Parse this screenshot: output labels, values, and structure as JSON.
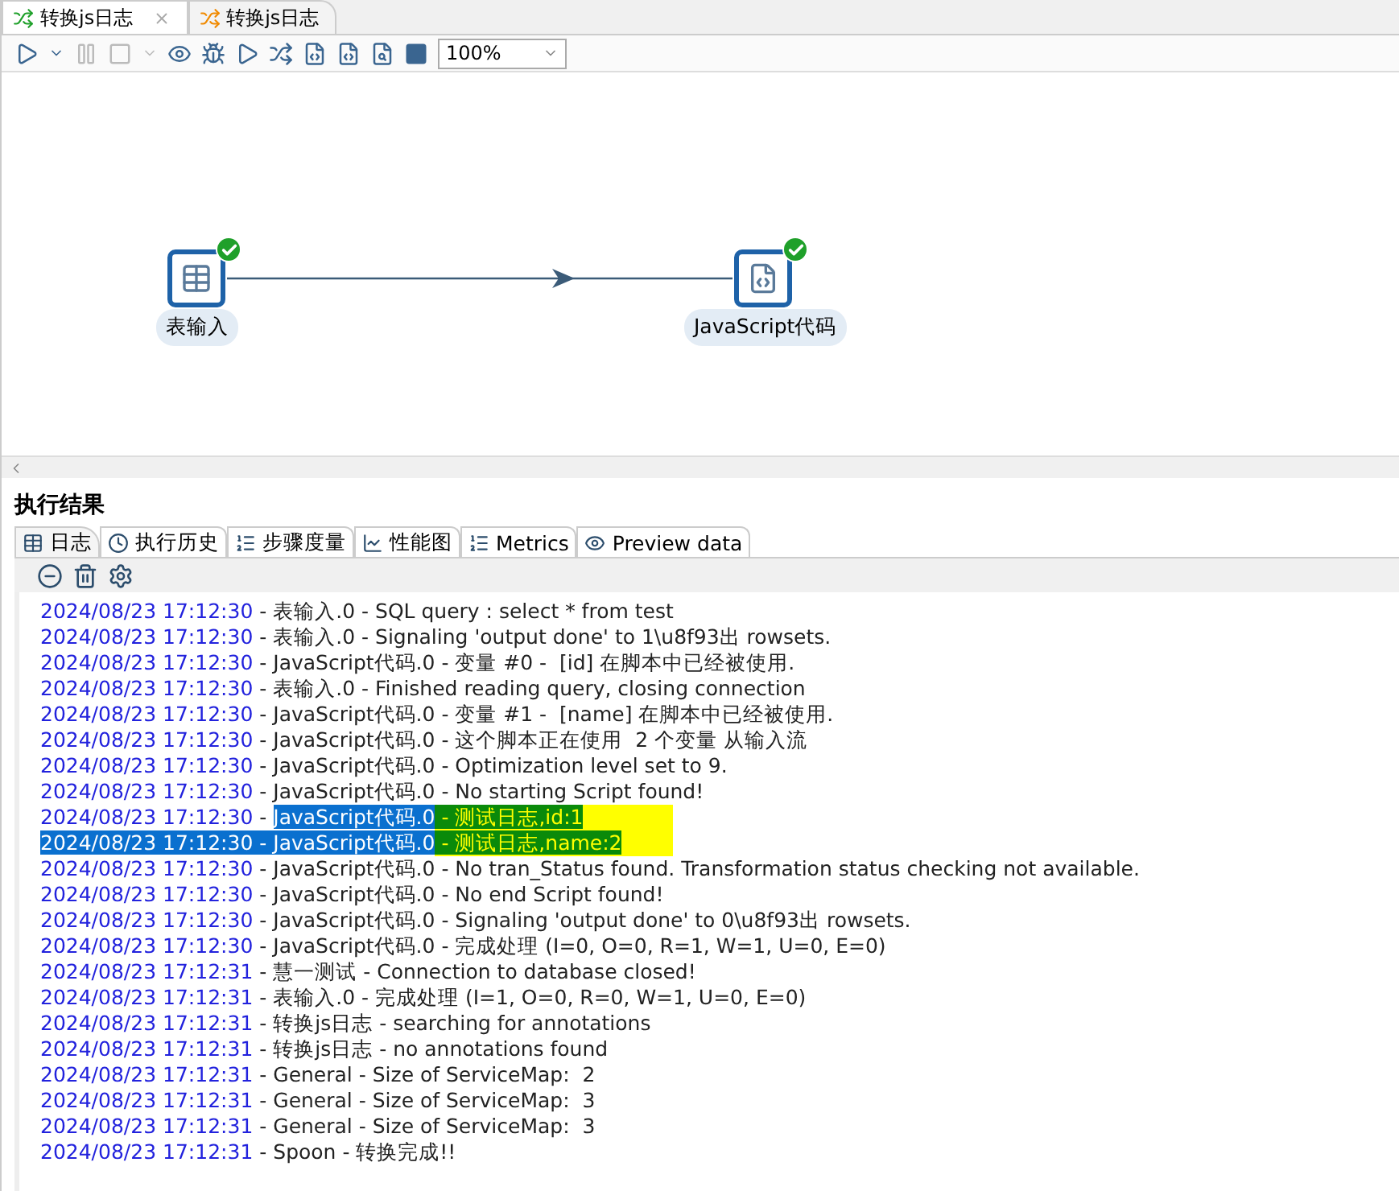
{
  "editor_tabs": [
    {
      "label": "转换js日志",
      "selected": true,
      "closable": true
    },
    {
      "label": "转换js日志",
      "selected": false,
      "closable": false
    }
  ],
  "toolbar": {
    "zoom": "100%"
  },
  "canvas": {
    "nodes": [
      {
        "label": "表输入",
        "kind": "table-input",
        "ok": true
      },
      {
        "label": "JavaScript代码",
        "kind": "script",
        "ok": true
      }
    ]
  },
  "results": {
    "title": "执行结果",
    "tabs": [
      {
        "label": "日志",
        "selected": true
      },
      {
        "label": "执行历史",
        "selected": false
      },
      {
        "label": "步骤度量",
        "selected": false
      },
      {
        "label": "性能图",
        "selected": false
      },
      {
        "label": "Metrics",
        "selected": false
      },
      {
        "label": "Preview data",
        "selected": false
      }
    ],
    "log": [
      {
        "time": "2024/08/23 17:12:30",
        "segments": [
          {
            "text": " - 表输入.0 - SQL query : select * from test",
            "selected": false,
            "highlighted": false
          }
        ],
        "time_selected": false
      },
      {
        "time": "2024/08/23 17:12:30",
        "segments": [
          {
            "text": " - 表输入.0 - Signaling 'output done' to 1\\u8f93出 rowsets.",
            "selected": false,
            "highlighted": false
          }
        ],
        "time_selected": false
      },
      {
        "time": "2024/08/23 17:12:30",
        "segments": [
          {
            "text": " - JavaScript代码.0 - 变量 #0 -  [id] 在脚本中已经被使用.",
            "selected": false,
            "highlighted": false
          }
        ],
        "time_selected": false
      },
      {
        "time": "2024/08/23 17:12:30",
        "segments": [
          {
            "text": " - 表输入.0 - Finished reading query, closing connection",
            "selected": false,
            "highlighted": false
          }
        ],
        "time_selected": false
      },
      {
        "time": "2024/08/23 17:12:30",
        "segments": [
          {
            "text": " - JavaScript代码.0 - 变量 #1 -  [name] 在脚本中已经被使用.",
            "selected": false,
            "highlighted": false
          }
        ],
        "time_selected": false
      },
      {
        "time": "2024/08/23 17:12:30",
        "segments": [
          {
            "text": " - JavaScript代码.0 - 这个脚本正在使用  2 个变量 从输入流",
            "selected": false,
            "highlighted": false
          }
        ],
        "time_selected": false
      },
      {
        "time": "2024/08/23 17:12:30",
        "segments": [
          {
            "text": " - JavaScript代码.0 - Optimization level set to 9.",
            "selected": false,
            "highlighted": false
          }
        ],
        "time_selected": false
      },
      {
        "time": "2024/08/23 17:12:30",
        "segments": [
          {
            "text": " - JavaScript代码.0 - No starting Script found!",
            "selected": false,
            "highlighted": false
          }
        ],
        "time_selected": false
      },
      {
        "time": "2024/08/23 17:12:30",
        "segments": [
          {
            "text": " - ",
            "selected": false,
            "highlighted": false
          },
          {
            "text": "JavaScript代码.0",
            "selected": true,
            "highlighted": false
          },
          {
            "text": " - 测试日志,id:1",
            "selected": true,
            "highlighted": true
          }
        ],
        "time_selected": false
      },
      {
        "time": "2024/08/23 17:12:30",
        "segments": [
          {
            "text": " - JavaScript代码.0",
            "selected": true,
            "highlighted": false
          },
          {
            "text": " - 测试日志,name:2",
            "selected": true,
            "highlighted": true
          }
        ],
        "time_selected": true
      },
      {
        "time": "2024/08/23 17:12:30",
        "segments": [
          {
            "text": " - JavaScript代码.0 - No tran_Status found. Transformation status checking not available.",
            "selected": false,
            "highlighted": false
          }
        ],
        "time_selected": false
      },
      {
        "time": "2024/08/23 17:12:30",
        "segments": [
          {
            "text": " - JavaScript代码.0 - No end Script found!",
            "selected": false,
            "highlighted": false
          }
        ],
        "time_selected": false
      },
      {
        "time": "2024/08/23 17:12:30",
        "segments": [
          {
            "text": " - JavaScript代码.0 - Signaling 'output done' to 0\\u8f93出 rowsets.",
            "selected": false,
            "highlighted": false
          }
        ],
        "time_selected": false
      },
      {
        "time": "2024/08/23 17:12:30",
        "segments": [
          {
            "text": " - JavaScript代码.0 - 完成处理 (I=0, O=0, R=1, W=1, U=0, E=0)",
            "selected": false,
            "highlighted": false
          }
        ],
        "time_selected": false
      },
      {
        "time": "2024/08/23 17:12:31",
        "segments": [
          {
            "text": " - 慧一测试 - Connection to database closed!",
            "selected": false,
            "highlighted": false
          }
        ],
        "time_selected": false
      },
      {
        "time": "2024/08/23 17:12:31",
        "segments": [
          {
            "text": " - 表输入.0 - 完成处理 (I=1, O=0, R=0, W=1, U=0, E=0)",
            "selected": false,
            "highlighted": false
          }
        ],
        "time_selected": false
      },
      {
        "time": "2024/08/23 17:12:31",
        "segments": [
          {
            "text": " - 转换js日志 - searching for annotations",
            "selected": false,
            "highlighted": false
          }
        ],
        "time_selected": false
      },
      {
        "time": "2024/08/23 17:12:31",
        "segments": [
          {
            "text": " - 转换js日志 - no annotations found",
            "selected": false,
            "highlighted": false
          }
        ],
        "time_selected": false
      },
      {
        "time": "2024/08/23 17:12:31",
        "segments": [
          {
            "text": " - General - Size of ServiceMap:  2",
            "selected": false,
            "highlighted": false
          }
        ],
        "time_selected": false
      },
      {
        "time": "2024/08/23 17:12:31",
        "segments": [
          {
            "text": " - General - Size of ServiceMap:  3",
            "selected": false,
            "highlighted": false
          }
        ],
        "time_selected": false
      },
      {
        "time": "2024/08/23 17:12:31",
        "segments": [
          {
            "text": " - General - Size of ServiceMap:  3",
            "selected": false,
            "highlighted": false
          }
        ],
        "time_selected": false
      },
      {
        "time": "2024/08/23 17:12:31",
        "segments": [
          {
            "text": " - Spoon - 转换完成!!",
            "selected": false,
            "highlighted": false
          }
        ],
        "time_selected": false
      }
    ]
  }
}
